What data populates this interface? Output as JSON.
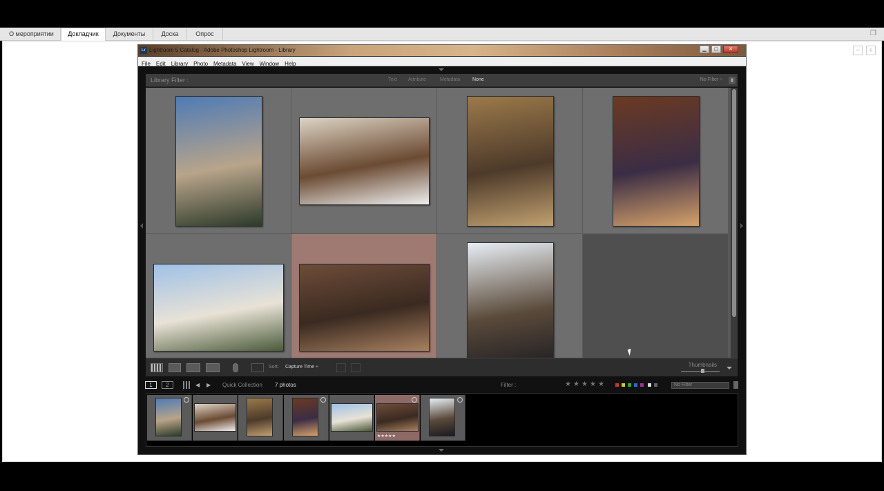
{
  "tabs": [
    {
      "label": "О мероприятии",
      "active": false
    },
    {
      "label": "Докладчик",
      "active": true
    },
    {
      "label": "Документы",
      "active": false
    },
    {
      "label": "Доска",
      "active": false
    },
    {
      "label": "Опрос",
      "active": false
    }
  ],
  "outer_controls": {
    "minus": "−",
    "plus": "+"
  },
  "lightroom": {
    "logo": "Lr",
    "title": "Lightroom 5 Catalog - Adobe Photoshop Lightroom - Library",
    "window_buttons": {
      "minimize": "▁",
      "maximize": "▢",
      "close": "✕"
    },
    "menu": [
      "File",
      "Edit",
      "Library",
      "Photo",
      "Metadata",
      "View",
      "Window",
      "Help"
    ],
    "filter_bar": {
      "title": "Library Filter :",
      "options": [
        "Text",
        "Attribute",
        "Metadata",
        "None"
      ],
      "selected": "None",
      "preset": "No Filter ÷"
    },
    "grid": {
      "photos": [
        {
          "subject": "sky-lake-sunset",
          "colors": [
            "#4f7bb5",
            "#b8a48a",
            "#2d3a2a"
          ]
        },
        {
          "subject": "bride-restaurant",
          "colors": [
            "#ddd3c4",
            "#6b4b33",
            "#eeeeee"
          ]
        },
        {
          "subject": "couple-painted-hall",
          "colors": [
            "#9b7a4a",
            "#4d3a2a",
            "#c0a070"
          ]
        },
        {
          "subject": "couple-vintage-train",
          "colors": [
            "#6b3a22",
            "#3b2d45",
            "#d4a16a"
          ]
        },
        {
          "subject": "couple-old-building",
          "colors": [
            "#9fc1e6",
            "#e8e2d6",
            "#4b5b3a"
          ]
        },
        {
          "subject": "couple-brick-loft",
          "colors": [
            "#6e4c3a",
            "#3a2a20",
            "#a88060"
          ]
        },
        {
          "subject": "woman-winter-forest",
          "colors": [
            "#e8eef5",
            "#5a4a3a",
            "#1a1a22"
          ]
        }
      ],
      "selected_index": 5
    },
    "toolbar": {
      "sort_label": "Sort:",
      "sort_value": "Capture Time ÷",
      "thumbnails_label": "Thumbnails"
    },
    "filmstrip_bar": {
      "screen1": "1",
      "screen2": "2",
      "source": "Quick Collection",
      "count": "7 photos",
      "filter_label": "Filter :",
      "filter_value": "No Filter"
    },
    "filmstrip": {
      "selected_index": 5,
      "stars": "★★★★★"
    }
  }
}
